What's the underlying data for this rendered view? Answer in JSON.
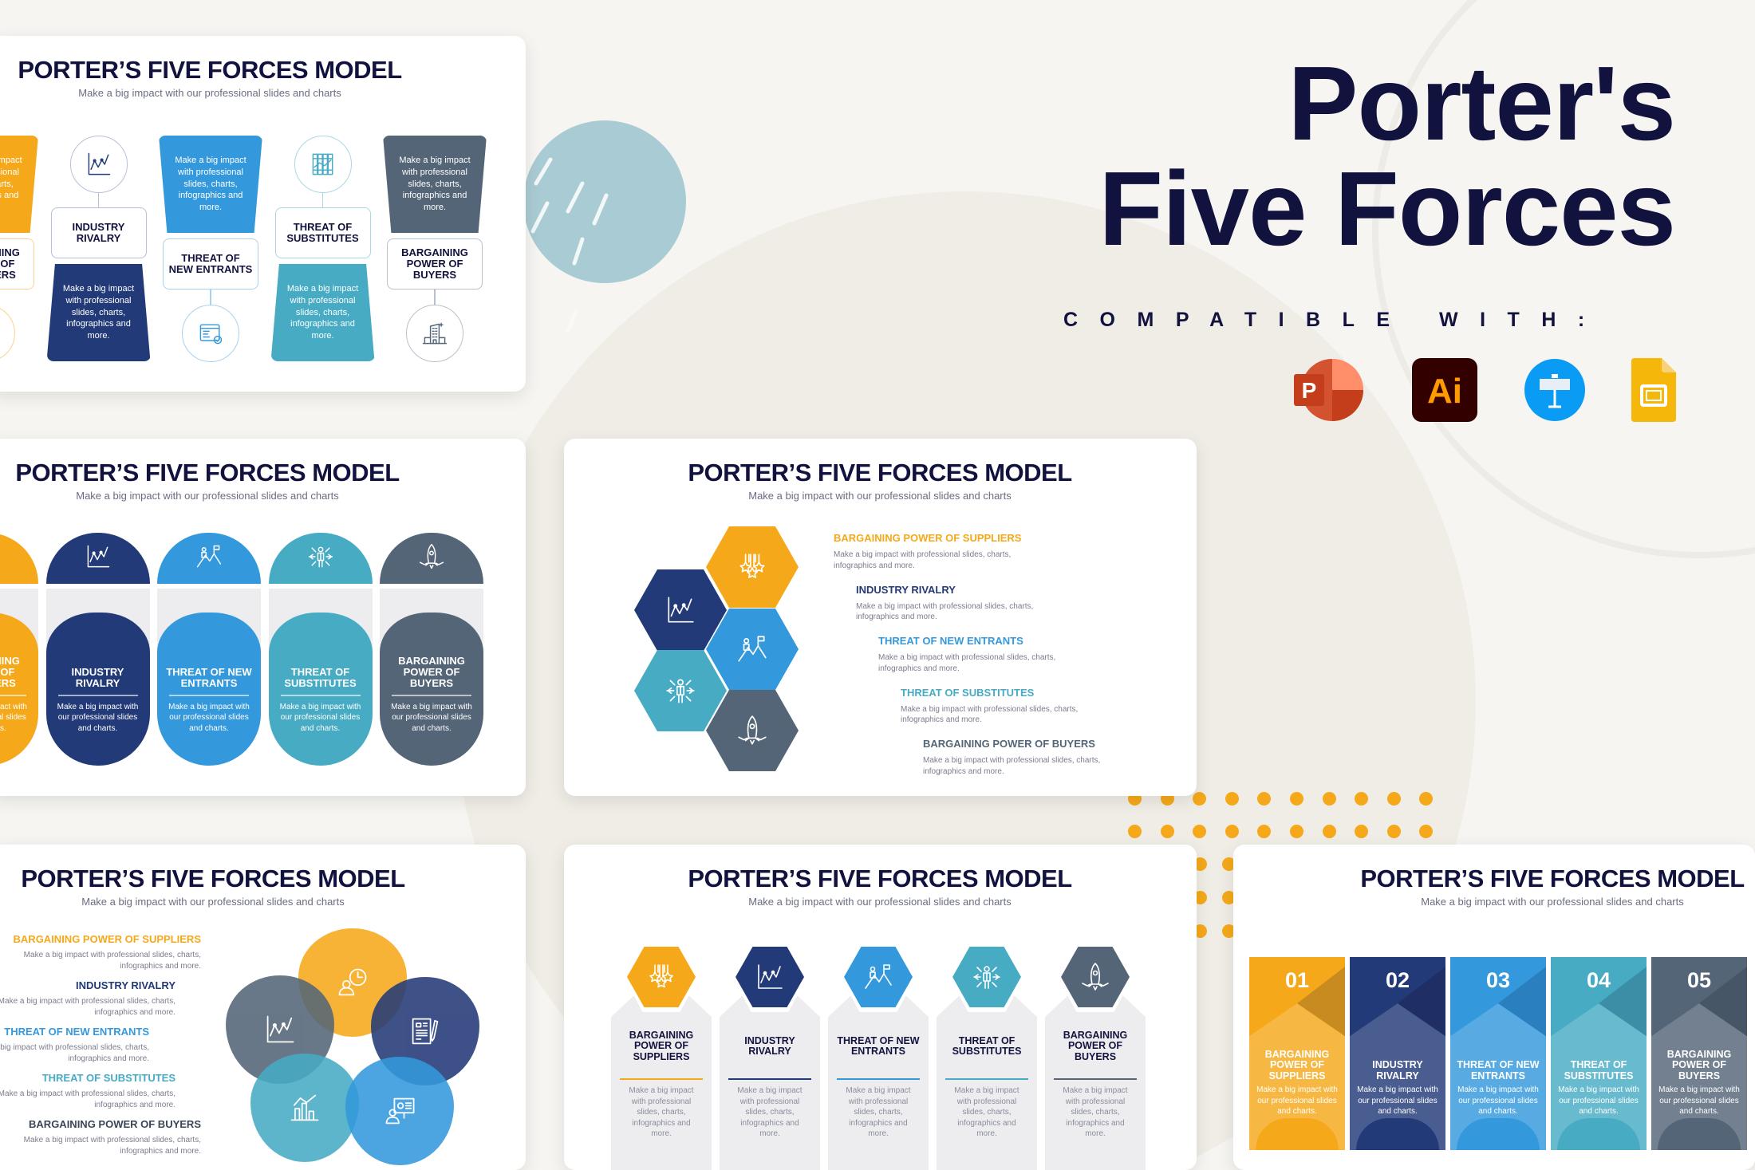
{
  "hero": {
    "title_line1": "Porter's",
    "title_line2": "Five Forces",
    "compatible_label": "COMPATIBLE WITH:",
    "apps": [
      {
        "name": "PowerPoint",
        "icon": "powerpoint-icon",
        "letter": "P",
        "color": "#d35230"
      },
      {
        "name": "Illustrator",
        "icon": "illustrator-icon",
        "letter": "Ai",
        "color": "#330000"
      },
      {
        "name": "Keynote",
        "icon": "keynote-icon",
        "color": "#0a9cf5"
      },
      {
        "name": "Google Slides",
        "icon": "google-slides-icon",
        "color": "#f6b70b"
      }
    ]
  },
  "slide_title": "PORTER’S FIVE FORCES MODEL",
  "slide_subtitle": "Make a big impact with our professional slides and charts",
  "desc_long": "Make a big impact with professional slides, charts, infographics and more.",
  "desc_short": "Make a big impact with our professional slides and charts.",
  "forces": [
    {
      "label": "BARGAINING POWER OF SUPPLIERS",
      "number": "01",
      "color": "#f5a91a",
      "icon": "medals-icon"
    },
    {
      "label": "INDUSTRY RIVALRY",
      "number": "02",
      "color": "#233a78",
      "icon": "line-chart-icon"
    },
    {
      "label": "THREAT OF NEW ENTRANTS",
      "number": "03",
      "color": "#3499dc",
      "icon": "mountain-flag-icon"
    },
    {
      "label": "THREAT OF SUBSTITUTES",
      "number": "04",
      "color": "#47abc4",
      "icon": "people-arrows-icon"
    },
    {
      "label": "BARGAINING POWER OF BUYERS",
      "number": "05",
      "color": "#546577",
      "icon": "rocket-icon"
    }
  ],
  "slide1_icons": [
    "bar-chart-icon",
    "line-chart-icon",
    "browser-check-icon",
    "binders-icon",
    "building-icon"
  ],
  "slide4_icons": [
    "clock-person-icon",
    "line-chart-icon",
    "document-pen-icon",
    "bar-chart-icon",
    "presentation-icon"
  ],
  "colors": {
    "background": "#f6f5f1",
    "title": "#12123f",
    "decor_circle": "#a9cbd3",
    "dots": "#f5a91a"
  }
}
